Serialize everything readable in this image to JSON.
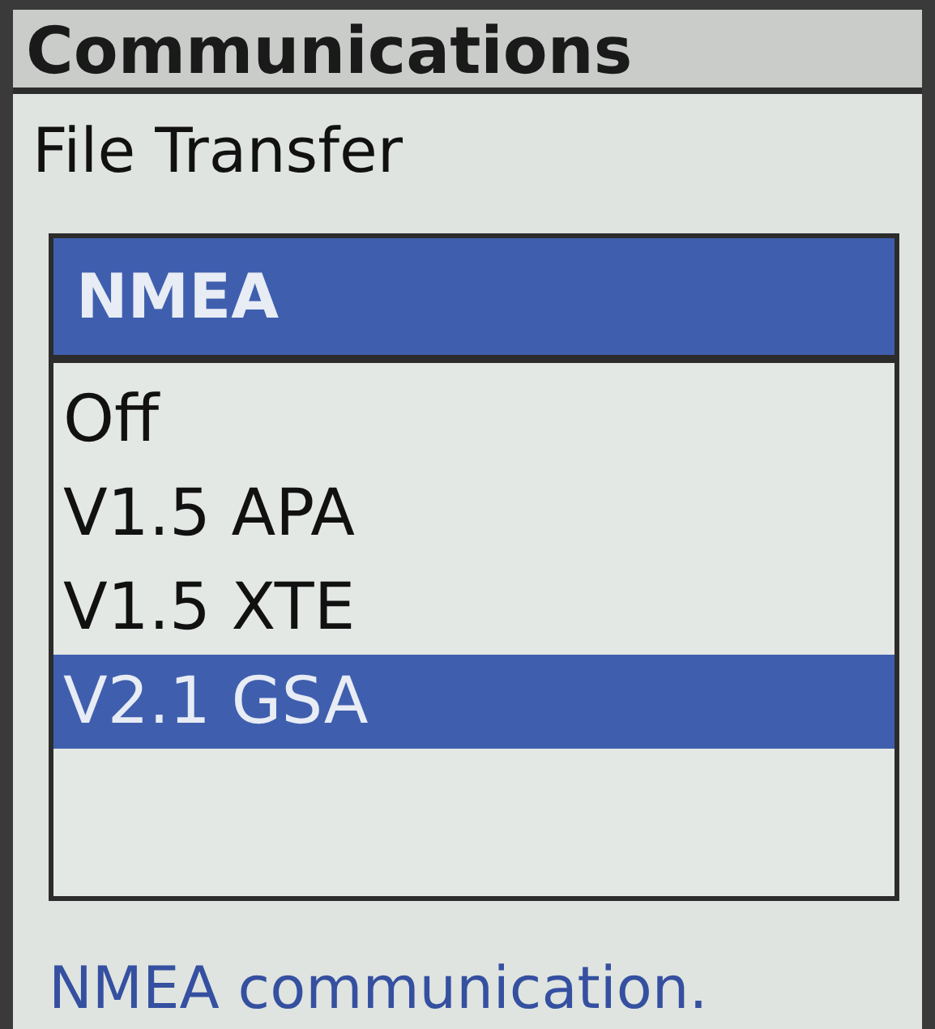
{
  "window": {
    "title": "Communications"
  },
  "field": {
    "label": "File Transfer"
  },
  "dropdown": {
    "title": "NMEA",
    "options": [
      {
        "label": "Off",
        "selected": false
      },
      {
        "label": "V1.5 APA",
        "selected": false
      },
      {
        "label": "V1.5 XTE",
        "selected": false
      },
      {
        "label": "V2.1 GSA",
        "selected": true
      }
    ]
  },
  "status_text": "NMEA communication."
}
